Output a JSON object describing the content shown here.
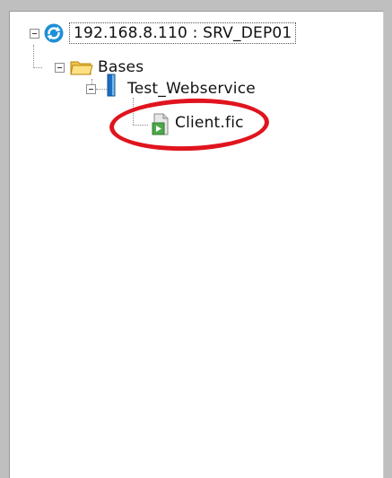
{
  "tree": {
    "root": {
      "label": "192.168.8.110 : SRV_DEP01",
      "icon": "refresh-server-icon",
      "expanded": true,
      "children": [
        {
          "label": "Bases",
          "icon": "folder-icon",
          "expanded": true,
          "children": [
            {
              "label": "Test_Webservice",
              "icon": "database-icon",
              "expanded": true,
              "children": [
                {
                  "label": "Client.fic",
                  "icon": "file-icon"
                }
              ]
            }
          ]
        }
      ]
    }
  },
  "annotation": {
    "color": "#e0141e",
    "target": "Client.fic"
  }
}
